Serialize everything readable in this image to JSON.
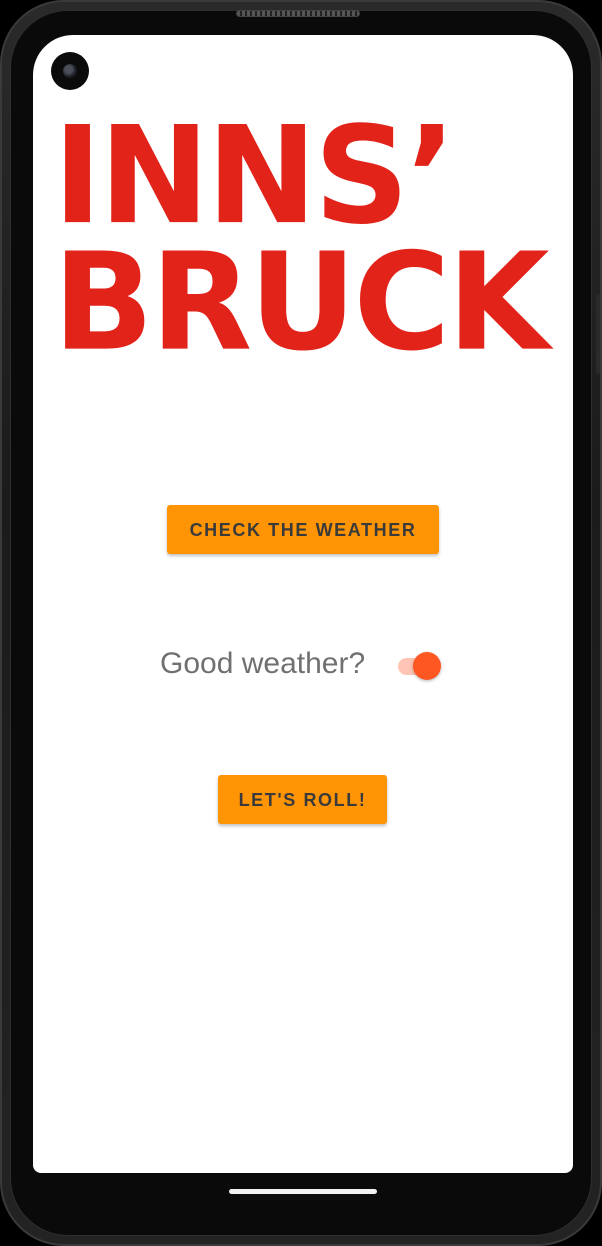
{
  "app": {
    "logo_line1": "INNS’",
    "logo_line2": "BRUCK",
    "logo_color": "#e2231a"
  },
  "buttons": {
    "check_weather": "CHECK THE WEATHER",
    "lets_roll": "LET'S ROLL!",
    "accent_color": "#ff9505"
  },
  "weather_toggle": {
    "label": "Good weather?",
    "checked": true,
    "thumb_color": "#ff5722",
    "track_color": "#ffc4b4"
  },
  "device": {
    "front_camera_icon": "camera-icon",
    "home_indicator_icon": "home-indicator"
  }
}
